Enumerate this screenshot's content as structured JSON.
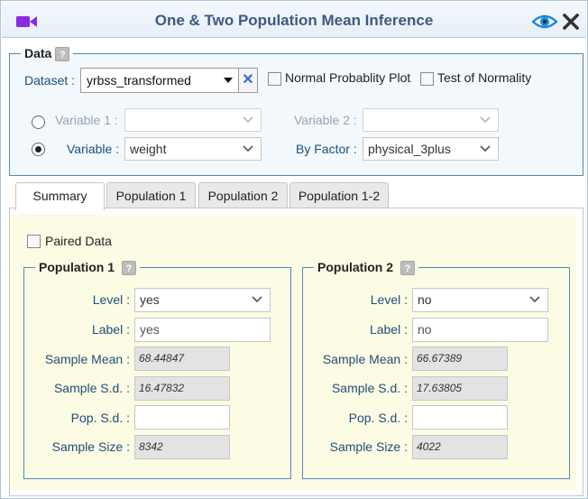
{
  "window": {
    "title": "One & Two Population Mean Inference",
    "icons": {
      "left": "video-camera-icon",
      "preview": "eye-icon",
      "close": "close-icon"
    },
    "colors": {
      "title": "#3d5a80",
      "camera": "#8a2be2",
      "preview": "#1e88d6",
      "fieldset_border": "#4e8ab7",
      "panel_bg": "#fcfbe4"
    }
  },
  "data_section": {
    "legend": "Data",
    "help": "?",
    "dataset_label": "Dataset :",
    "dataset_value": "yrbss_transformed",
    "clear_symbol": "✕",
    "normal_plot_label": "Normal Probablity Plot",
    "normality_test_label": "Test of Normality",
    "variable1_label": "Variable 1 :",
    "variable1_value": "",
    "variable2_label": "Variable 2 :",
    "variable2_value": "",
    "variable_label": "Variable :",
    "variable_value": "weight",
    "by_factor_label": "By Factor :",
    "by_factor_value": "physical_3plus",
    "selected_mode": "variable"
  },
  "tabs": [
    {
      "label": "Summary",
      "active": true
    },
    {
      "label": "Population 1",
      "active": false
    },
    {
      "label": "Population 2",
      "active": false
    },
    {
      "label": "Population 1-2",
      "active": false
    }
  ],
  "summary": {
    "paired_label": "Paired Data",
    "paired_checked": false,
    "pop1": {
      "legend": "Population 1",
      "help": "?",
      "level_label": "Level :",
      "level_value": "yes",
      "label_label": "Label :",
      "label_value": "yes",
      "mean_label": "Sample Mean :",
      "mean_value": "68.44847",
      "sd_label": "Sample S.d. :",
      "sd_value": "16.47832",
      "popsd_label": "Pop. S.d. :",
      "popsd_value": "",
      "size_label": "Sample Size :",
      "size_value": "8342"
    },
    "pop2": {
      "legend": "Population 2",
      "help": "?",
      "level_label": "Level :",
      "level_value": "no",
      "label_label": "Label :",
      "label_value": "no",
      "mean_label": "Sample Mean :",
      "mean_value": "66.67389",
      "sd_label": "Sample S.d. :",
      "sd_value": "17.63805",
      "popsd_label": "Pop. S.d. :",
      "popsd_value": "",
      "size_label": "Sample Size :",
      "size_value": "4022"
    }
  }
}
